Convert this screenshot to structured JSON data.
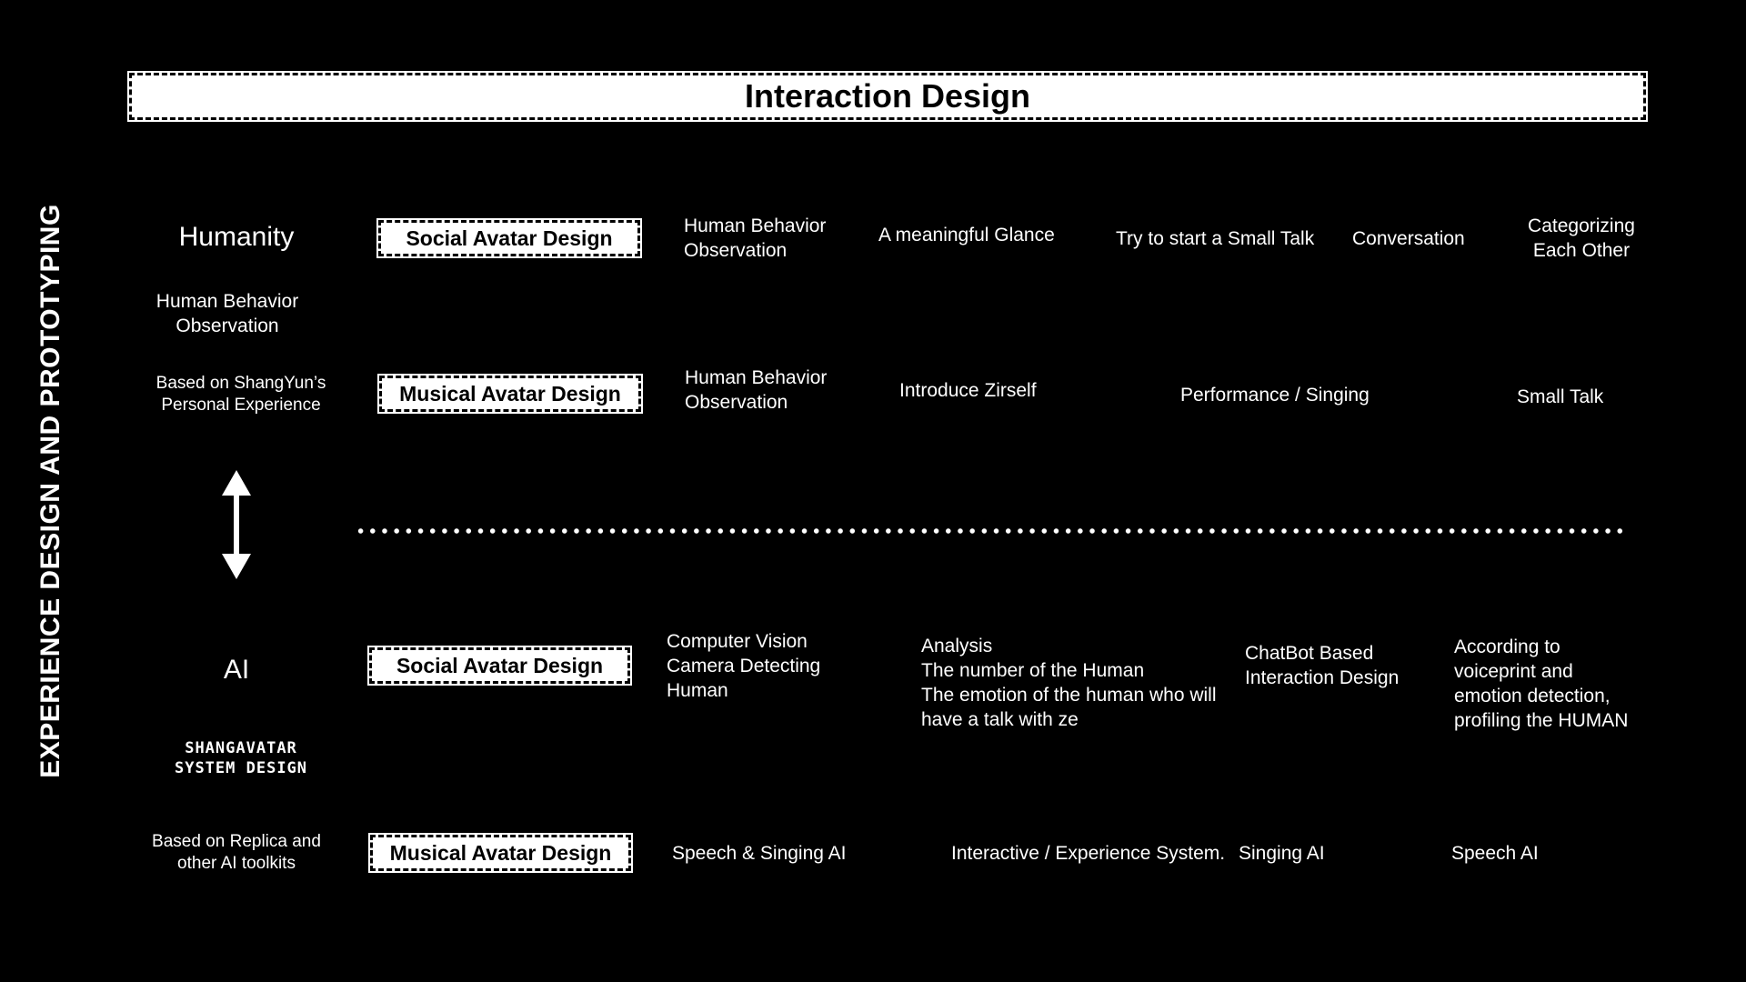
{
  "banner": {
    "title": "Interaction Design"
  },
  "side_title": "EXPERIENCE DESIGN AND PROTOTYPING",
  "humanity_section": {
    "title": "Humanity",
    "subtitle": "Human Behavior\nObservation",
    "note": "Based on ShangYun’s\nPersonal Experience"
  },
  "ai_section": {
    "title": "AI",
    "subtitle": "SHANGAVATAR\nSYSTEM DESIGN",
    "note": "Based on Replica and\nother AI toolkits"
  },
  "rows": {
    "human_social": {
      "tag": "Social Avatar Design",
      "steps": [
        "Human Behavior\nObservation",
        "A meaningful Glance",
        "Try to start a Small Talk",
        "Conversation",
        "Categorizing\nEach Other"
      ]
    },
    "human_musical": {
      "tag": "Musical Avatar Design",
      "steps": [
        "Human Behavior\nObservation",
        "Introduce Zirself",
        "Performance / Singing",
        "Small Talk"
      ]
    },
    "ai_social": {
      "tag": "Social Avatar Design",
      "steps": [
        "Computer Vision\nCamera Detecting\nHuman",
        "Analysis\nThe number of the Human\nThe emotion of the human who will\nhave a talk with ze",
        "ChatBot Based\nInteraction Design",
        "According to\nvoiceprint and\nemotion detection,\nprofiling the HUMAN"
      ]
    },
    "ai_musical": {
      "tag": "Musical Avatar Design",
      "steps": [
        "Speech & Singing AI",
        "Interactive / Experience System.",
        "Singing AI",
        "Speech AI"
      ]
    }
  },
  "icons": {
    "separator": "dotted-line",
    "connector": "double-arrow-icon"
  },
  "colors": {
    "background": "#000000",
    "foreground": "#ffffff",
    "tag_text": "#000000"
  }
}
